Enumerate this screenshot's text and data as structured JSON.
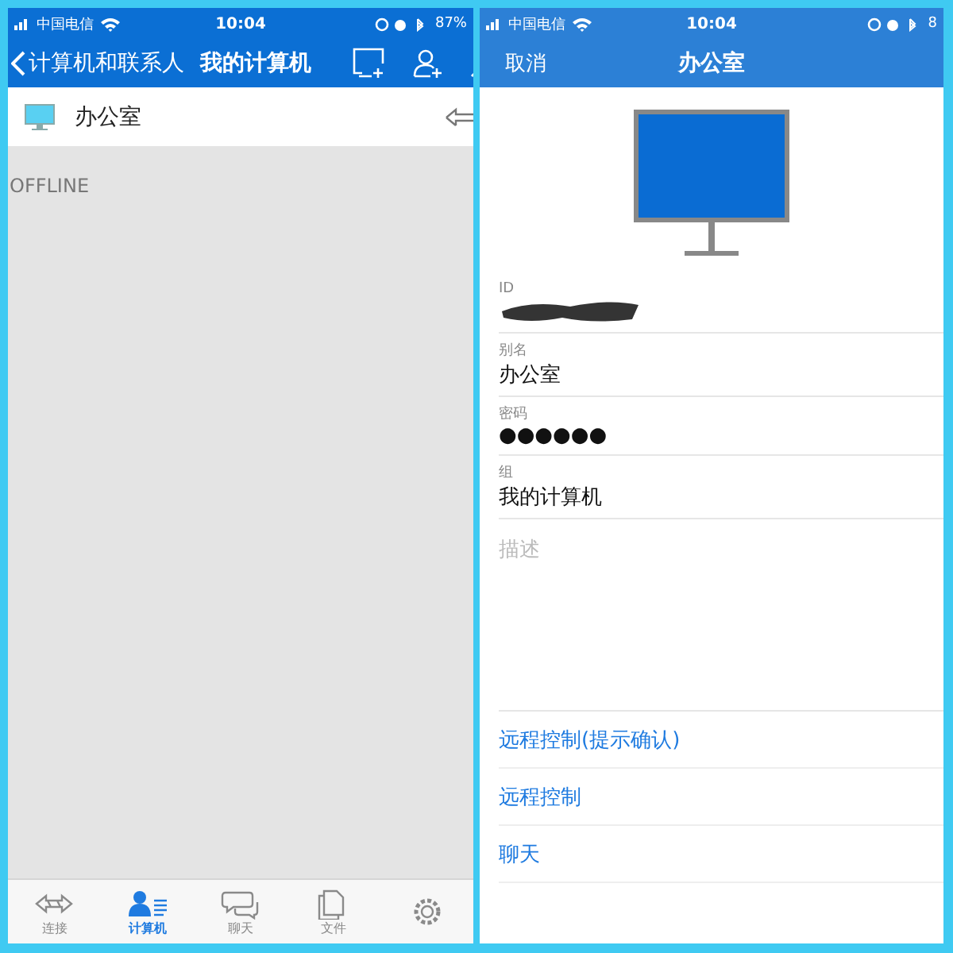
{
  "left": {
    "status_bar": {
      "carrier": "中国电信",
      "time": "10:04",
      "battery": "87%"
    },
    "nav": {
      "back": "计算机和联系人",
      "title": "我的计算机"
    },
    "computers": [
      {
        "name": "办公室"
      }
    ],
    "section": "OFFLINE",
    "tabs": [
      {
        "label": "连接",
        "kind": "connect",
        "selected": false
      },
      {
        "label": "计算机",
        "kind": "computers",
        "selected": true
      },
      {
        "label": "聊天",
        "kind": "chat",
        "selected": false
      },
      {
        "label": "文件",
        "kind": "files",
        "selected": false
      },
      {
        "kind": "settings",
        "selected": false
      }
    ]
  },
  "right": {
    "status_bar": {
      "carrier": "中国电信",
      "time": "10:04",
      "battery": "8"
    },
    "nav": {
      "cancel": "取消",
      "title": "办公室"
    },
    "fields": [
      {
        "label": "ID",
        "kind": "redacted"
      },
      {
        "label": "别名",
        "value": "办公室",
        "kind": "text"
      },
      {
        "label": "密码",
        "value": "●●●●●●",
        "kind": "text"
      },
      {
        "label": "组",
        "value": "我的计算机",
        "kind": "text"
      }
    ],
    "description": {
      "placeholder": "描述"
    },
    "actions": [
      "远程控制(提示确认)",
      "远程控制",
      "聊天"
    ]
  }
}
